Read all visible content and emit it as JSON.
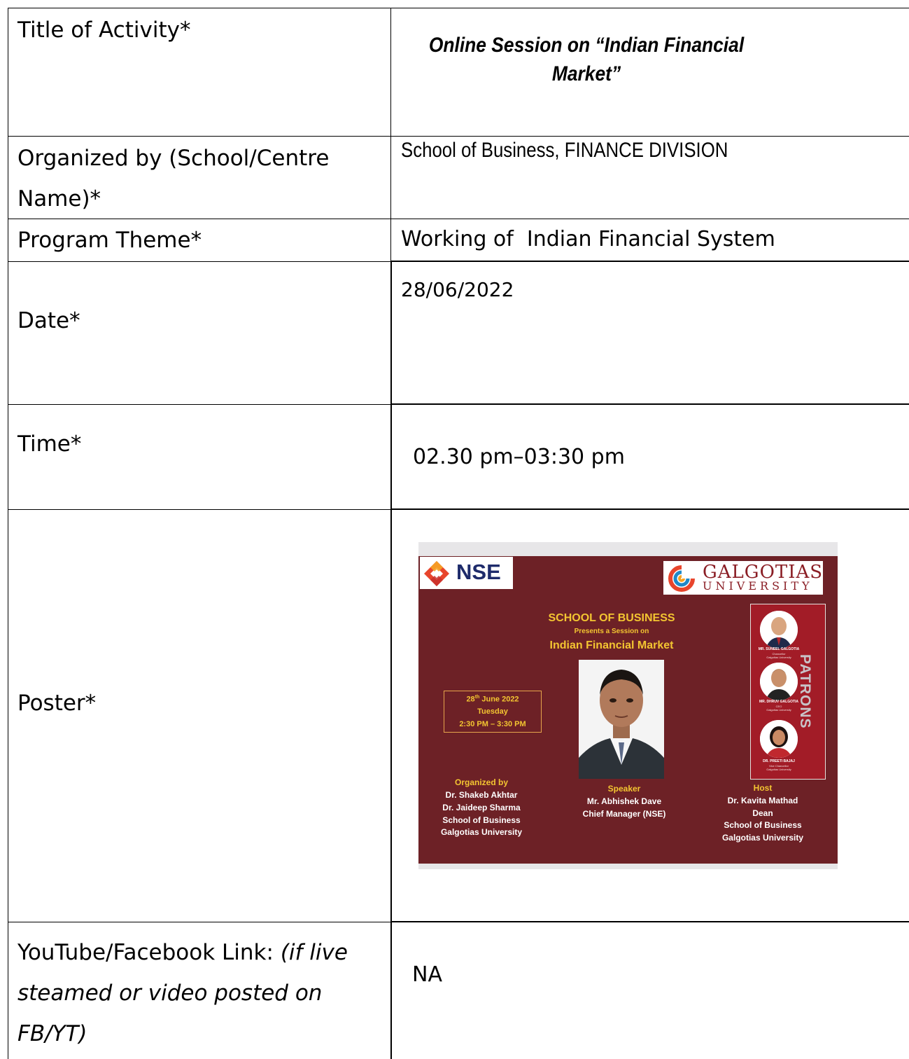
{
  "rows": {
    "title": {
      "label": "Title of Activity*",
      "value_line1": "Online Session on “Indian Financial",
      "value_line2": "Market”"
    },
    "organized": {
      "label_line1": "Organized by (School/Centre",
      "label_line2": "Name)*",
      "value": "School of Business, FINANCE DIVISION"
    },
    "theme": {
      "label": "Program Theme*",
      "value": "Working of  Indian Financial System"
    },
    "date": {
      "label": "Date*",
      "value": "28/06/2022"
    },
    "time": {
      "label": "Time*",
      "value": "02.30 pm–03:30 pm"
    },
    "poster": {
      "label": "Poster*"
    },
    "link": {
      "label_plain": "YouTube/Facebook Link: ",
      "label_italic_1": "(if live",
      "label_italic_2": "steamed or video posted on",
      "label_italic_3": "FB/YT)",
      "value": "NA"
    }
  },
  "poster": {
    "colors": {
      "background": "#6d2126",
      "accent": "#f3c531",
      "panel": "#a21c27"
    },
    "nse_logo_text": "NSE",
    "university_logo_line1": "GALGOTIAS",
    "university_logo_line2": "UNIVERSITY",
    "school": "SCHOOL OF BUSINESS",
    "presents": "Presents a Session on",
    "session_title": "Indian Financial Market",
    "date_day": "28",
    "date_suffix": "th",
    "date_rest": " June 2022",
    "weekday": "Tuesday",
    "time": "2:30 PM – 3:30 PM",
    "patrons_label": "PATRONS",
    "patrons": [
      {
        "name": "MR. SUNEEL GALGOTIA",
        "role": "Chancellor",
        "org": "Galgotias University"
      },
      {
        "name": "MR. DHRUV GALGOTIA",
        "role": "CEO",
        "org": "Galgotias University"
      },
      {
        "name": "DR. PREETI BAJAJ",
        "role": "Vice Chancellor",
        "org": "Galgotias University"
      }
    ],
    "organized_heading": "Organized by",
    "organizers": [
      "Dr. Shakeb Akhtar",
      "Dr. Jaideep Sharma",
      "School of Business",
      "Galgotias University"
    ],
    "speaker_heading": "Speaker",
    "speaker": [
      "Mr. Abhishek Dave",
      "Chief Manager (NSE)"
    ],
    "host_heading": "Host",
    "host": [
      "Dr. Kavita Mathad",
      "Dean",
      "School of Business",
      "Galgotias University"
    ]
  }
}
